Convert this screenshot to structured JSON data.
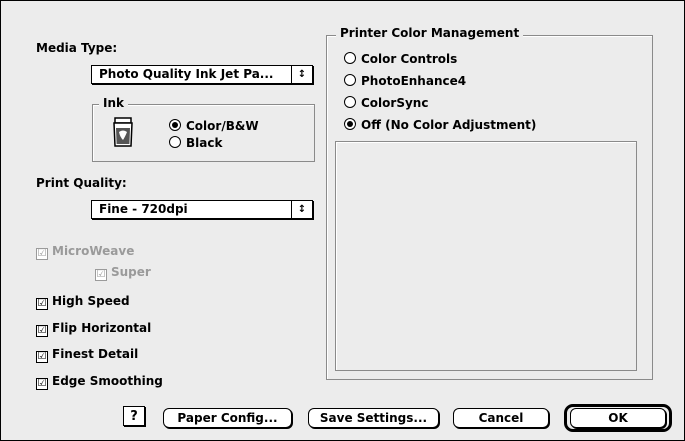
{
  "media_type": {
    "label": "Media Type:",
    "value": "Photo Quality Ink Jet Pa...",
    "arrow_glyph": "↕"
  },
  "ink": {
    "title": "Ink",
    "options": [
      {
        "label": "Color/B&W",
        "selected": true
      },
      {
        "label": "Black",
        "selected": false
      }
    ],
    "icon": "ink-cartridge-icon"
  },
  "print_quality": {
    "label": "Print Quality:",
    "value": "Fine - 720dpi",
    "arrow_glyph": "↕"
  },
  "checkboxes": [
    {
      "label": "MicroWeave",
      "checked": true,
      "disabled": true
    },
    {
      "label": "Super",
      "checked": true,
      "disabled": true
    },
    {
      "label": "High Speed",
      "checked": true,
      "disabled": false
    },
    {
      "label": "Flip Horizontal",
      "checked": true,
      "disabled": false
    },
    {
      "label": "Finest Detail",
      "checked": true,
      "disabled": false
    },
    {
      "label": "Edge Smoothing",
      "checked": true,
      "disabled": false
    }
  ],
  "color_management": {
    "title": "Printer Color Management",
    "options": [
      {
        "label": "Color Controls",
        "selected": false
      },
      {
        "label": "PhotoEnhance4",
        "selected": false
      },
      {
        "label": "ColorSync",
        "selected": false
      },
      {
        "label": "Off (No Color Adjustment)",
        "selected": true
      }
    ]
  },
  "buttons": {
    "help": "?",
    "paper_config": "Paper Config...",
    "save_settings": "Save Settings...",
    "cancel": "Cancel",
    "ok": "OK"
  },
  "check_glyph": "☑"
}
